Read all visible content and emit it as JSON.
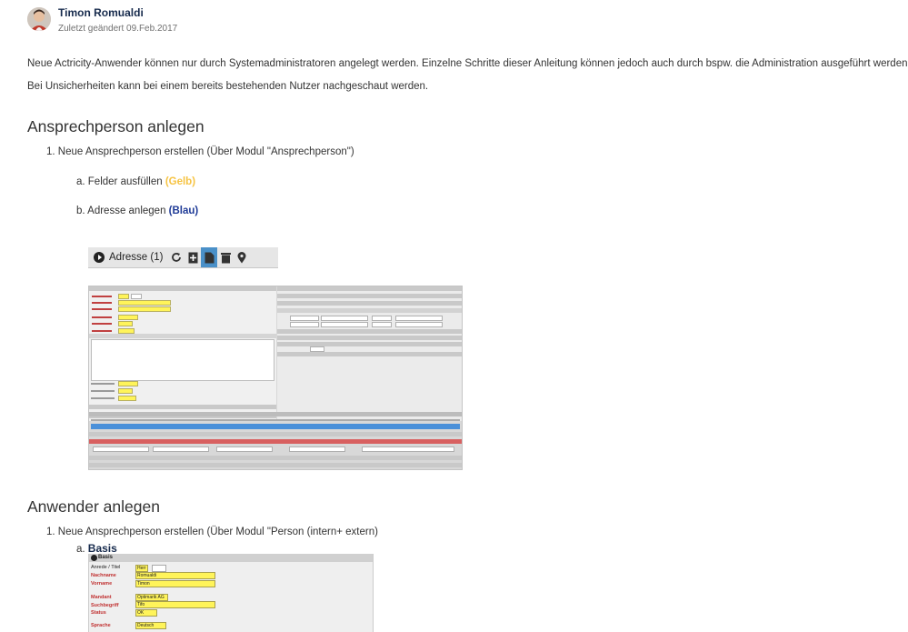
{
  "header": {
    "author": "Timon Romualdi",
    "meta": "Zuletzt geändert 09.Feb.2017"
  },
  "body": {
    "intro_1": "Neue Actricity-Anwender können nur durch Systemadministratoren angelegt werden. Einzelne Schritte dieser Anleitung können jedoch auch durch bspw. die Administration ausgeführt werden.",
    "intro_2": "Bei Unsicherheiten kann bei einem bereits bestehenden Nutzer nachgeschaut werden."
  },
  "section1": {
    "heading": "Ansprechperson anlegen",
    "step1": "1. Neue Ansprechperson erstellen (Über Modul \"Ansprechperson\")",
    "step_a_text": "a. Felder ausfüllen ",
    "step_a_highlight": "(Gelb)",
    "step_b_text": "b. Adresse anlegen ",
    "step_b_highlight": "(Blau)",
    "toolbar_label": "Adresse (1)"
  },
  "section2": {
    "heading": "Anwender anlegen",
    "step1": "1. Neue Ansprechperson erstellen (Über Modul \"Person (intern+ extern)",
    "step_a_prefix": "a. ",
    "step_a_bold": "Basis"
  },
  "basis_form": {
    "title": "Basis",
    "labels": [
      "Anrede / Titel",
      "Nachname",
      "Vorname",
      "Mandant",
      "Suchbegriff",
      "Status",
      "Sprache"
    ],
    "values": {
      "anrede": "Herr",
      "nachname": "Romualdi",
      "vorname": "Timon",
      "mandant": "Optimarik AG",
      "suchbegriff": "Tifo",
      "status": "OK",
      "sprache": "Deutsch"
    }
  },
  "colors": {
    "highlight_yellow": "#f6c342",
    "highlight_blue": "#1f3b97",
    "field_yellow": "#fff45a",
    "toolbar_active": "#4a90c8"
  }
}
